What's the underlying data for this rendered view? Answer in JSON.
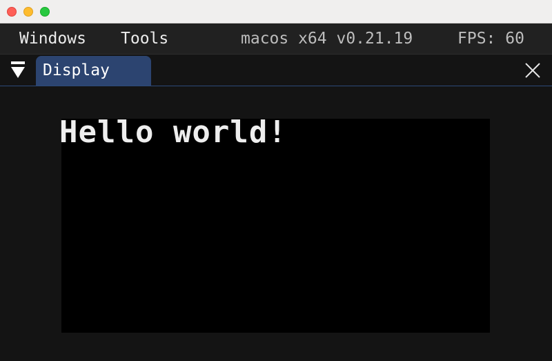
{
  "window": {
    "traffic_lights": {
      "close_color": "#fe5f57",
      "minimize_color": "#febc2e",
      "zoom_color": "#28c840"
    }
  },
  "menubar": {
    "items": [
      {
        "label": "Windows"
      },
      {
        "label": "Tools"
      }
    ],
    "version": "macos x64 v0.21.19",
    "fps": "FPS: 60"
  },
  "tabbar": {
    "collapse_icon": "triangle-down-icon",
    "active_tab": {
      "label": "Display",
      "color": "#2c4470"
    },
    "close_icon": "close-icon"
  },
  "display": {
    "text": "Hello world!",
    "background": "#000000"
  }
}
